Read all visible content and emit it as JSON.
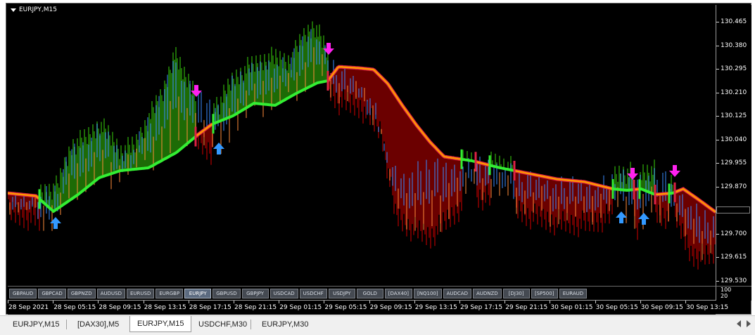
{
  "window": {
    "title": "EURJPY,M15"
  },
  "price_axis": {
    "labels": [
      "130.465",
      "130.380",
      "130.295",
      "130.210",
      "130.125",
      "130.040",
      "129.955",
      "129.870",
      "129.785",
      "129.700",
      "129.615",
      "129.530"
    ],
    "current_price": "129.785"
  },
  "sub_axis": {
    "top": "100",
    "bottom": "20"
  },
  "time_axis": {
    "labels": [
      "28 Sep 2021",
      "28 Sep 05:15",
      "28 Sep 09:15",
      "28 Sep 13:15",
      "28 Sep 17:15",
      "28 Sep 21:15",
      "29 Sep 01:15",
      "29 Sep 05:15",
      "29 Sep 09:15",
      "29 Sep 13:15",
      "29 Sep 17:15",
      "29 Sep 21:15",
      "30 Sep 01:15",
      "30 Sep 05:15",
      "30 Sep 09:15",
      "30 Sep 13:15"
    ]
  },
  "symbol_buttons": [
    "GBPAUD",
    "GBPCAD",
    "GBPNZD",
    "AUDUSD",
    "EURUSD",
    "EURGBP",
    "EURJPY",
    "GBPUSD",
    "GBPJPY",
    "USDCAD",
    "USDCHF",
    "USDJPY",
    "GOLD",
    "[DAX40]",
    "[NQ100]",
    "AUDCAD",
    "AUDNZD",
    "[DJ30]",
    "[SP500]",
    "EURAUD"
  ],
  "active_symbol": "EURJPY",
  "tabs": [
    {
      "label": "EURJPY,M15",
      "active": false
    },
    {
      "label": "[DAX30],M5",
      "active": false
    },
    {
      "label": "EURJPY,M15",
      "active": true
    },
    {
      "label": "USDCHF,M30",
      "active": false
    },
    {
      "label": "EURJPY,M30",
      "active": false
    }
  ],
  "colors": {
    "bull_fill": "#1d6b06",
    "bear_fill": "#6b0000",
    "bull_band": "#33ee33",
    "bear_band": "#ff9900",
    "bear_band_inner": "#dd2244",
    "up_arrow": "#3399ff",
    "down_arrow": "#ff22ee",
    "candle_up": "#3a8cff",
    "candle_down": "#ff8c3a"
  },
  "icons": {
    "title_menu": "triangle-down-icon",
    "buy_signal": "up-arrow-icon",
    "sell_signal": "down-arrow-icon",
    "tab_left": "triangle-left-icon",
    "tab_right": "triangle-right-icon"
  }
}
